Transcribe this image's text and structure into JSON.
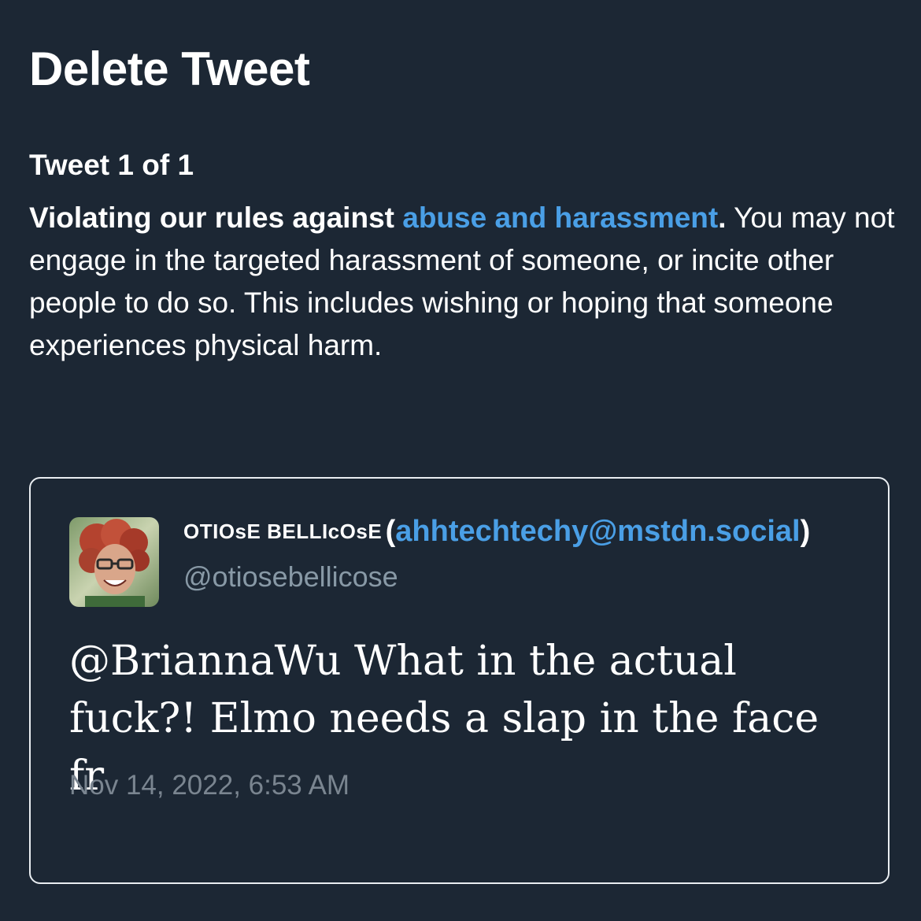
{
  "dialog": {
    "title": "Delete Tweet",
    "tweet_count": "Tweet 1 of 1",
    "violation": {
      "lead": "Violating our rules against ",
      "rule_link": "abuse and harassment",
      "period": ".",
      "description": "You may not engage in the targeted harassment of someone, or incite other people to do so. This includes wishing or hoping that someone experiences physical harm."
    }
  },
  "tweet": {
    "display_name": "OTIOsE BELLIcOsE",
    "paren_open": "(",
    "mastodon_handle": "ahhtechtechy@mstdn.social",
    "paren_close": ")",
    "handle": "@otiosebellicose",
    "text": "@BriannaWu What in the actual fuck?! Elmo needs a slap in the face fr",
    "timestamp": "Nov 14, 2022, 6:53 AM",
    "avatar_icon": "profile-photo"
  },
  "colors": {
    "background": "#1c2734",
    "link": "#4a9fe6",
    "muted_text": "#8899a6",
    "card_border": "#e9edf1"
  }
}
